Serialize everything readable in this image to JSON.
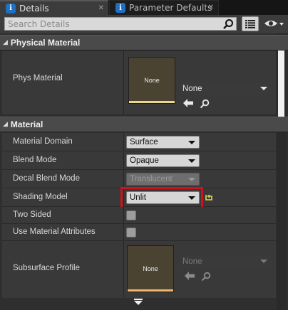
{
  "tabs": [
    {
      "label": "Details",
      "icon": "info-icon",
      "active": true
    },
    {
      "label": "Parameter Defaults",
      "icon": "info-icon",
      "active": false
    }
  ],
  "search": {
    "placeholder": "Search Details"
  },
  "categories": {
    "physical": "Physical Material",
    "material": "Material"
  },
  "physical_material": {
    "name": "Phys Material",
    "thumbnail_label": "None",
    "value": "None"
  },
  "material": {
    "domain": {
      "name": "Material Domain",
      "value": "Surface"
    },
    "blend": {
      "name": "Blend Mode",
      "value": "Opaque"
    },
    "decal": {
      "name": "Decal Blend Mode",
      "value": "Translucent"
    },
    "shading": {
      "name": "Shading Model",
      "value": "Unlit"
    },
    "two_sided": {
      "name": "Two Sided",
      "checked": false
    },
    "use_attrs": {
      "name": "Use Material Attributes",
      "checked": false
    },
    "subsurface": {
      "name": "Subsurface Profile",
      "thumbnail_label": "None",
      "value": "None"
    }
  },
  "colors": {
    "highlight": "#d0101a",
    "tab_icon": "#1f6fc2"
  }
}
